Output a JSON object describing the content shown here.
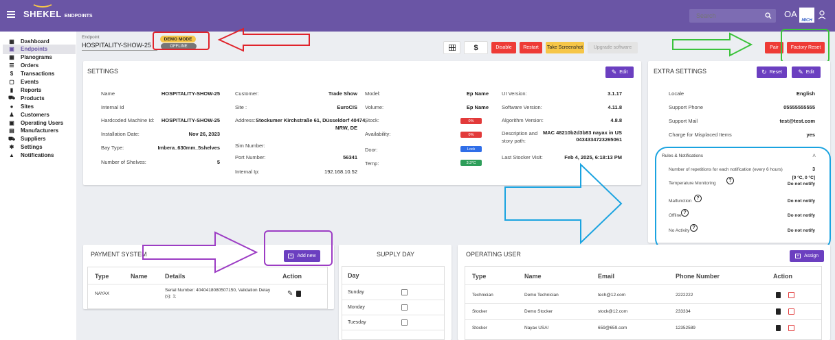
{
  "topbar": {
    "menu_icon": "menu-icon",
    "brand": "SHEKEL",
    "brand_sub": "ENDPOINTS",
    "search_placeholder": "Search",
    "user_initials": "OA",
    "logo_text": "MICH"
  },
  "sidebar": {
    "items": [
      {
        "label": "Dashboard",
        "icon": "dashboard-icon"
      },
      {
        "label": "Endpoints",
        "icon": "endpoints-icon"
      },
      {
        "label": "Planograms",
        "icon": "grid-icon"
      },
      {
        "label": "Orders",
        "icon": "list-icon"
      },
      {
        "label": "Transactions",
        "icon": "dollar-icon"
      },
      {
        "label": "Events",
        "icon": "calendar-icon"
      },
      {
        "label": "Reports",
        "icon": "chart-icon"
      },
      {
        "label": "Products",
        "icon": "cart-icon"
      },
      {
        "label": "Sites",
        "icon": "location-icon"
      },
      {
        "label": "Customers",
        "icon": "people-icon"
      },
      {
        "label": "Operating Users",
        "icon": "badge-icon"
      },
      {
        "label": "Manufacturers",
        "icon": "factory-icon"
      },
      {
        "label": "Suppliers",
        "icon": "truck-icon"
      },
      {
        "label": "Settings",
        "icon": "gear-icon"
      },
      {
        "label": "Notifications",
        "icon": "bell-icon"
      }
    ]
  },
  "endpoint": {
    "caption": "Endpoint",
    "name": "HOSPITALITY-SHOW-25",
    "demo_badge": "DEMO MODE",
    "status_badge": "OFFLINE"
  },
  "toolbar": {
    "disable": "Disable",
    "restart": "Restart",
    "screenshot": "Take Screenshot",
    "upgrade": "Upgrade software",
    "pair": "Pair",
    "factory_reset": "Factory Reset"
  },
  "settings": {
    "title": "SETTINGS",
    "edit": "Edit",
    "col1": [
      {
        "k": "Name",
        "v": "HOSPITALITY-SHOW-25"
      },
      {
        "k": "Internal Id",
        "v": ""
      },
      {
        "k": "Hardcoded Machine Id:",
        "v": "HOSPITALITY-SHOW-25"
      },
      {
        "k": "Installation Date:",
        "v": "Nov 26, 2023"
      },
      {
        "k": "Bay Type:",
        "v": "Imbera_630mm_5shelves"
      },
      {
        "k": "Number of Shelves:",
        "v": "5"
      }
    ],
    "col2": {
      "customer_k": "Customer:",
      "customer_v": "Trade Show",
      "site_k": "Site :",
      "site_v": "EuroCIS",
      "address_k": "Address:",
      "address_v1": "Stockumer Kirchstraße 61, Düsseldorf 40474,",
      "address_v2": "NRW, DE",
      "sim_k": "Sim Number:",
      "port_k": "Port Number:",
      "port_v": "56341",
      "ip_k": "Internal Ip:",
      "ip_v": "192.168.10.52"
    },
    "col3": {
      "model_k": "Model:",
      "model_v": "Ep Name",
      "volume_k": "Volume:",
      "volume_v": "Ep Name",
      "stock_k": "Stock:",
      "stock_v": "0%",
      "avail_k": "Availability:",
      "avail_v": "0%",
      "door_k": "Door:",
      "door_v": "Lock",
      "temp_k": "Temp:",
      "temp_v": "3.3°C"
    },
    "col4": {
      "ui_k": "UI Version:",
      "ui_v": "3.1.17",
      "sw_k": "Software Version:",
      "sw_v": "4.11.8",
      "algo_k": "Algorithm Version:",
      "algo_v": "4.8.8",
      "desc_k1": "Description and",
      "desc_k2": "story path:",
      "desc_v1": "MAC 48210b2d3b83 nayax in US",
      "desc_v2": "0434334723265061",
      "visit_k": "Last Stocker Visit:",
      "visit_v": "Feb 4, 2025, 6:18:13 PM"
    }
  },
  "extra": {
    "title": "EXTRA SETTINGS",
    "reset": "Reset",
    "edit": "Edit",
    "rows": [
      {
        "k": "Locale",
        "v": "English"
      },
      {
        "k": "Support Phone",
        "v": "05555555555"
      },
      {
        "k": "Support Mail",
        "v": "test@test.com"
      },
      {
        "k": "Charge for Misplaced Items",
        "v": "yes"
      }
    ],
    "rules_title": "Rules & Notifications",
    "repetitions_k": "Number of repetitions for each notification (every 6 hours)",
    "repetitions_v": "3",
    "temp_k": "Temperature Monitoring",
    "temp_range": "[0 °C, 0 °C]",
    "temp_v": "Do not notify",
    "malfunction_k": "Malfunction",
    "malfunction_v": "Do not notify",
    "offline_k": "Offline",
    "offline_v": "Do not notify",
    "noactivity_k": "No Activity",
    "noactivity_v": "Do not notify"
  },
  "payment": {
    "title": "PAYMENT SYSTEM",
    "add": "Add new",
    "headers": [
      "Type",
      "Name",
      "Details",
      "Action"
    ],
    "rows": [
      {
        "type": "NAYAX",
        "name": "",
        "details1": "Serial Number: 4040418080507150, Validation Delay",
        "details2": "(s): 1;"
      }
    ]
  },
  "supply": {
    "title": "SUPPLY DAY",
    "header": "Day",
    "days": [
      "Sunday",
      "Monday",
      "Tuesday"
    ]
  },
  "operating": {
    "title": "OPERATING USER",
    "assign": "Assign",
    "headers": [
      "Type",
      "Name",
      "Email",
      "Phone Number",
      "Action"
    ],
    "rows": [
      {
        "type": "Technician",
        "name": "Demo Technician",
        "email": "tech@12.com",
        "phone": "2222222"
      },
      {
        "type": "Stocker",
        "name": "Demo Stocker",
        "email": "stock@12.com",
        "phone": "233334"
      },
      {
        "type": "Stocker",
        "name": "Nayax USA!",
        "email": "659@659.com",
        "phone": "12352589"
      }
    ]
  },
  "colors": {
    "topbar": "#6a55a5",
    "accent": "#6b3fc0",
    "danger": "#ee3b36",
    "warning": "#f6d04d",
    "success": "#2e9e5a",
    "info": "#2f6ee8"
  }
}
